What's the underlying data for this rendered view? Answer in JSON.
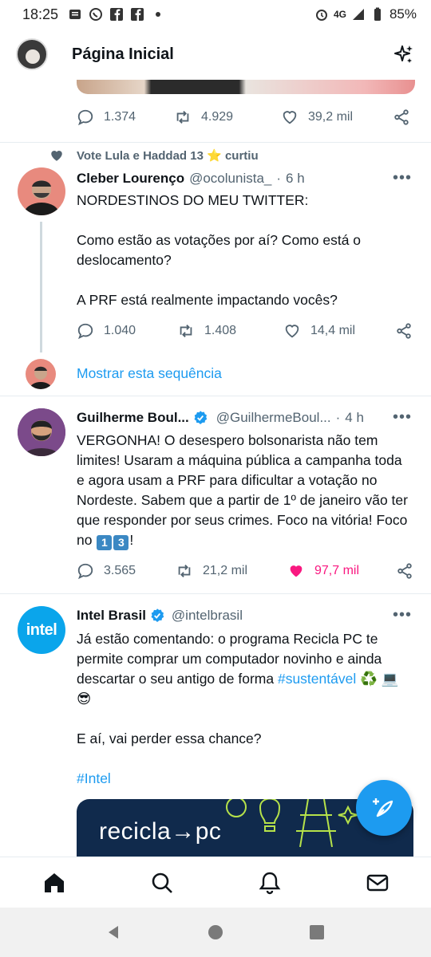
{
  "status_bar": {
    "time": "18:25",
    "network": "4G",
    "battery": "85%",
    "left_icons": [
      "message-icon",
      "whatsapp-icon",
      "facebook-icon",
      "facebook-icon",
      "dot-icon"
    ],
    "right_icons": [
      "alarm-icon",
      "signal-icon",
      "battery-icon"
    ]
  },
  "header": {
    "title": "Página Inicial",
    "right_icon": "sparkle-icon"
  },
  "top_tweet_actions": {
    "replies": "1.374",
    "retweets": "4.929",
    "likes": "39,2 mil"
  },
  "tweets": [
    {
      "social_context": "Vote Lula e Haddad 13 ⭐ curtiu",
      "name": "Cleber Lourenço",
      "handle": "@ocolunista_",
      "time": "6 h",
      "paragraphs": [
        "NORDESTINOS DO MEU TWITTER:",
        "",
        "Como estão as votações por aí? Como está o deslocamento?",
        "",
        "A PRF está realmente impactando vocês?"
      ],
      "replies": "1.040",
      "retweets": "1.408",
      "likes": "14,4 mil",
      "show_thread": "Mostrar esta sequência"
    },
    {
      "name": "Guilherme Boul...",
      "handle": "@GuilhermeBoul...",
      "time": "4 h",
      "text": "VERGONHA! O desespero bolsonarista não tem limites! Usaram a máquina pública a campanha toda e agora usam a PRF para dificultar a votação no Nordeste. Sabem que a partir de 1º de janeiro vão ter que responder por seus crimes. Foco na vitória! Foco no",
      "keycaps": [
        "1",
        "3"
      ],
      "text_end": "!",
      "replies": "3.565",
      "retweets": "21,2 mil",
      "likes": "97,7 mil",
      "liked": true
    },
    {
      "name": "Intel Brasil",
      "handle": "@intelbrasil",
      "text_1": "Já estão comentando: o programa Recicla PC te permite comprar um computador novinho e ainda descartar o seu antigo de forma",
      "hashtag_1": "#sustentável",
      "emoji_1": "♻️ 💻😎",
      "text_2": "E aí, vai perder essa chance?",
      "hashtag_2": "#Intel",
      "card_text": "recicla→pc",
      "avatar_text": "intel"
    }
  ],
  "colors": {
    "accent": "#1d9bf0",
    "like_active": "#f91880",
    "text_secondary": "#536471"
  },
  "bottom_nav": [
    "home-icon",
    "search-icon",
    "notifications-icon",
    "messages-icon"
  ]
}
